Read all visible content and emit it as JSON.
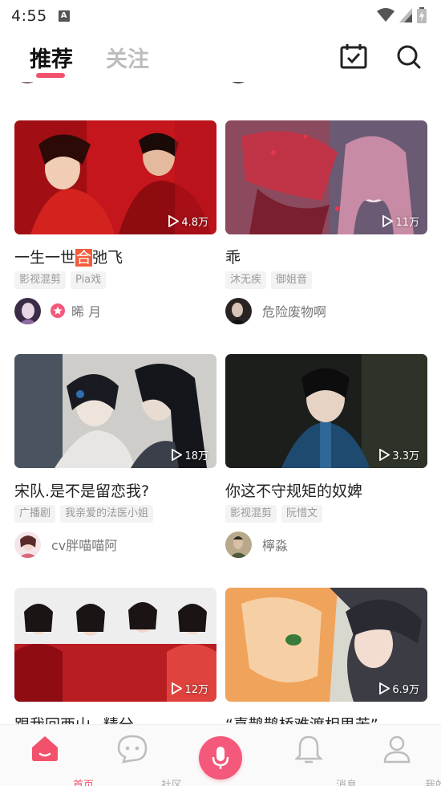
{
  "status_bar": {
    "time": "4:55",
    "app_badge": "A"
  },
  "header": {
    "tab_recommend": "推荐",
    "tab_follow": "关注",
    "accent_color": "#f3516b"
  },
  "cards": [
    {
      "title_pre": "一生一世",
      "title_hl": "合",
      "title_post": "弛飞",
      "plays": "4.8万",
      "tags": [
        "影视混剪",
        "Pia戏"
      ],
      "author": "晞 月",
      "verified": true
    },
    {
      "title_pre": "乖",
      "title_hl": "",
      "title_post": "",
      "plays": "11万",
      "tags": [
        "沐无疾",
        "御姐音"
      ],
      "author": "危险废物啊",
      "verified": false
    },
    {
      "title_pre": "宋队.是不是留恋我?",
      "title_hl": "",
      "title_post": "",
      "plays": "18万",
      "tags": [
        "广播剧",
        "我亲爱的法医小姐"
      ],
      "author": "cv胖喵喵阿",
      "verified": false
    },
    {
      "title_pre": "你这不守规矩的奴婢",
      "title_hl": "",
      "title_post": "",
      "plays": "3.3万",
      "tags": [
        "影视混剪",
        "阮惜文"
      ],
      "author": "檸淼",
      "verified": false
    },
    {
      "title_pre": "跟我回西山~精分",
      "title_hl": "",
      "title_post": "",
      "plays": "12万",
      "tags": [],
      "author": "",
      "verified": false
    },
    {
      "title_pre": "“喜鹊鹊桥难渡相思苦”",
      "title_hl": "",
      "title_post": "",
      "plays": "6.9万",
      "tags": [],
      "author": "",
      "verified": false
    }
  ],
  "bottom_nav": {
    "home": "首页",
    "community": "社区",
    "messages": "消息",
    "mine": "我的"
  }
}
